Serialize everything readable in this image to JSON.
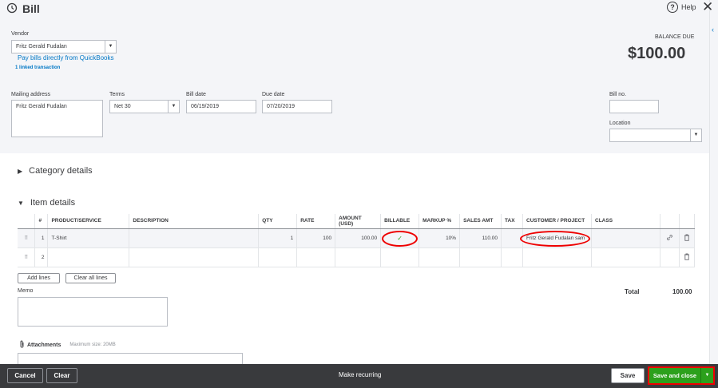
{
  "window": {
    "title": "Bill",
    "help_label": "Help"
  },
  "vendor": {
    "label": "Vendor",
    "value": "Fritz Gerald Fudalan",
    "pay_link": "Pay bills directly from QuickBooks",
    "linked": "1 linked transaction"
  },
  "balance": {
    "label": "BALANCE DUE",
    "amount": "$100.00"
  },
  "mailing": {
    "label": "Mailing address",
    "value": "Fritz Gerald Fudalan"
  },
  "terms": {
    "label": "Terms",
    "value": "Net 30"
  },
  "bill_date": {
    "label": "Bill date",
    "value": "06/19/2019"
  },
  "due_date": {
    "label": "Due date",
    "value": "07/20/2019"
  },
  "bill_no": {
    "label": "Bill no.",
    "value": ""
  },
  "location": {
    "label": "Location",
    "value": ""
  },
  "sections": {
    "category": "Category details",
    "item": "Item details"
  },
  "columns": {
    "num": "#",
    "product": "PRODUCT/SERVICE",
    "description": "DESCRIPTION",
    "qty": "QTY",
    "rate": "RATE",
    "amount": "AMOUNT (USD)",
    "billable": "BILLABLE",
    "markup": "MARKUP %",
    "sales_amt": "SALES AMT",
    "tax": "TAX",
    "customer": "CUSTOMER / PROJECT",
    "class": "CLASS"
  },
  "rows": [
    {
      "num": "1",
      "product": "T-Shirt",
      "description": "",
      "qty": "1",
      "rate": "100",
      "amount": "100.00",
      "billable": "✓",
      "markup": "10%",
      "sales_amt": "110.00",
      "tax": "",
      "customer": "Fritz Gerald Fudalan sam",
      "class": ""
    },
    {
      "num": "2",
      "product": "",
      "description": "",
      "qty": "",
      "rate": "",
      "amount": "",
      "billable": "",
      "markup": "",
      "sales_amt": "",
      "tax": "",
      "customer": "",
      "class": ""
    }
  ],
  "buttons": {
    "add_lines": "Add lines",
    "clear_lines": "Clear all lines"
  },
  "total": {
    "label": "Total",
    "value": "100.00"
  },
  "memo": {
    "label": "Memo"
  },
  "attachments": {
    "label": "Attachments",
    "max": "Maximum size: 20MB"
  },
  "footer": {
    "cancel": "Cancel",
    "clear": "Clear",
    "recurring": "Make recurring",
    "save": "Save",
    "save_close": "Save and close"
  },
  "colors": {
    "accent_green": "#2ca01c",
    "highlight_red": "#e00000",
    "footer_bg": "#393a3d"
  },
  "icons": [
    "history-icon",
    "help-icon",
    "close-icon",
    "link-icon",
    "trash-icon",
    "paperclip-icon",
    "drag-handle-icon"
  ]
}
